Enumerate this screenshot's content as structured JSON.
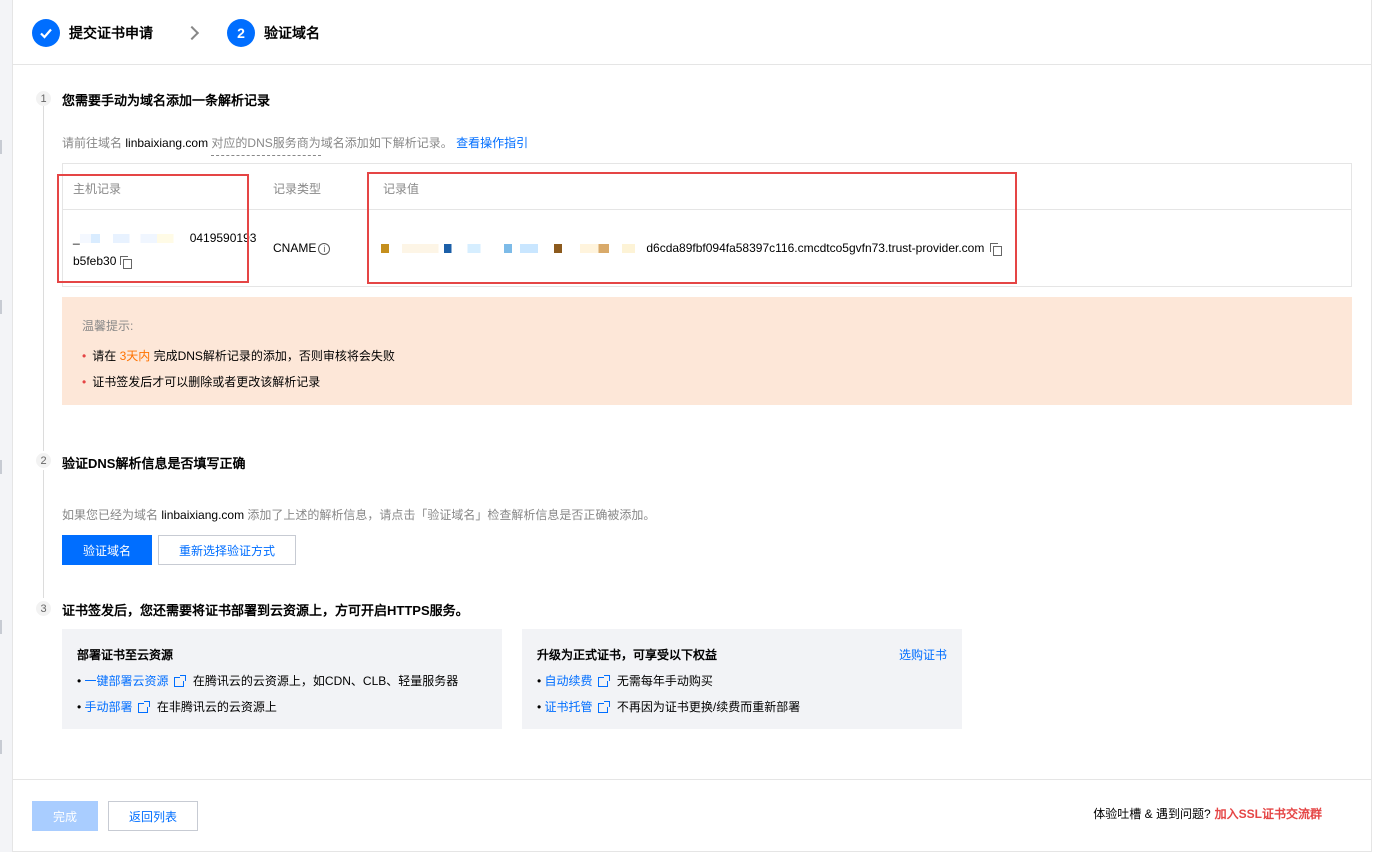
{
  "steps": [
    {
      "label": "提交证书申请",
      "done": true
    },
    {
      "label": "验证域名",
      "number": "2"
    }
  ],
  "section1": {
    "number": "1",
    "title": "您需要手动为域名添加一条解析记录",
    "hint_prefix": "请前往域名",
    "domain": "linbaixiang.com",
    "hint_dashed": "对应的DNS服务商为",
    "hint_suffix": "域名添加如下解析记录。",
    "guide_link": "查看操作指引",
    "table": {
      "headers": {
        "host": "主机记录",
        "type": "记录类型",
        "value": "记录值"
      },
      "host_prefix": "_",
      "host_visible": "0419590193",
      "host_line2": "b5feb30",
      "type": "CNAME",
      "value_visible": "d6cda89fbf094fa58397c116.cmcdtco5gvfn73.trust-provider.com"
    },
    "notice": {
      "title": "温馨提示:",
      "item1_prefix": "请在",
      "item1_highlight": "3天内",
      "item1_suffix": "完成DNS解析记录的添加，否则审核将会失败",
      "item2": "证书签发后才可以删除或者更改该解析记录"
    }
  },
  "section2": {
    "number": "2",
    "title": "验证DNS解析信息是否填写正确",
    "hint_prefix": "如果您已经为域名",
    "domain": "linbaixiang.com",
    "hint_suffix": "添加了上述的解析信息，请点击「验证域名」检查解析信息是否正确被添加。",
    "verify_button": "验证域名",
    "reselect_button": "重新选择验证方式"
  },
  "section3": {
    "number": "3",
    "title": "证书签发后，您还需要将证书部署到云资源上，方可开启HTTPS服务。",
    "card1": {
      "title": "部署证书至云资源",
      "items": [
        {
          "link": "一键部署云资源",
          "desc": "在腾讯云的云资源上，如CDN、CLB、轻量服务器"
        },
        {
          "link": "手动部署",
          "desc": "在非腾讯云的云资源上"
        }
      ]
    },
    "card2": {
      "title": "升级为正式证书，可享受以下权益",
      "buy_link": "选购证书",
      "items": [
        {
          "link": "自动续费",
          "desc": "无需每年手动购买"
        },
        {
          "link": "证书托管",
          "desc": "不再因为证书更换/续费而重新部署"
        }
      ]
    }
  },
  "footer": {
    "done_button": "完成",
    "back_button": "返回列表",
    "feedback_text": "体验吐槽 & 遇到问题?",
    "feedback_link": "加入SSL证书交流群"
  },
  "colors": {
    "primary": "#006eff",
    "warning": "#ff7200",
    "danger": "#e54545",
    "notice_bg": "#fde7d8"
  }
}
